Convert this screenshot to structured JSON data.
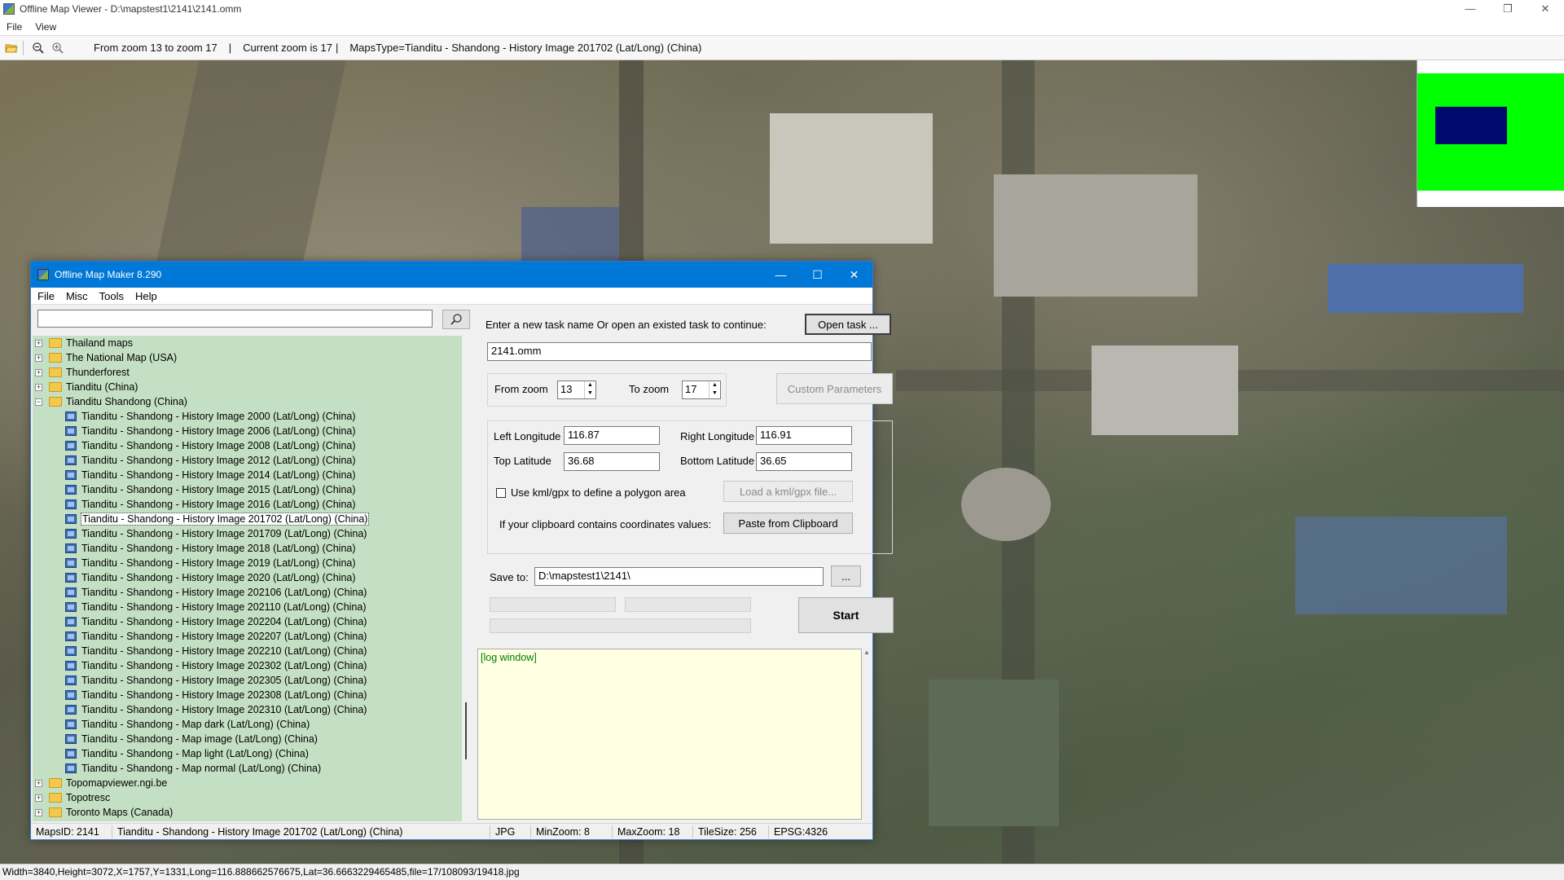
{
  "viewer": {
    "title": "Offline Map Viewer - D:\\mapstest1\\2141\\2141.omm",
    "controls": {
      "minimize": "—",
      "maximize": "❐",
      "close": "✕"
    },
    "menu": [
      "File",
      "View"
    ],
    "toolbar": {
      "zoom_range": "From zoom 13 to zoom 17",
      "current_zoom": "Current zoom is 17",
      "maps_type": "MapsType=Tianditu - Shandong - History Image 201702 (Lat/Long) (China)",
      "separator": "|"
    },
    "status": "Width=3840,Height=3072,X=1757,Y=1331,Long=116.888662576675,Lat=36.6663229465485,file=17/108093/19418.jpg"
  },
  "dialog": {
    "title": "Offline Map Maker 8.290",
    "controls": {
      "minimize": "—",
      "maximize": "☐",
      "close": "✕"
    },
    "menu": [
      "File",
      "Misc",
      "Tools",
      "Help"
    ],
    "search": {
      "value": ""
    },
    "tree": [
      {
        "level": 1,
        "expander": "+",
        "label": "Thailand maps"
      },
      {
        "level": 1,
        "expander": "+",
        "label": "The National Map (USA)"
      },
      {
        "level": 1,
        "expander": "+",
        "label": "Thunderforest"
      },
      {
        "level": 1,
        "expander": "+",
        "label": "Tianditu (China)"
      },
      {
        "level": 1,
        "expander": "−",
        "label": "Tianditu Shandong (China)"
      },
      {
        "level": 2,
        "label": "Tianditu - Shandong - History Image 2000 (Lat/Long) (China)"
      },
      {
        "level": 2,
        "label": "Tianditu - Shandong - History Image 2006 (Lat/Long) (China)"
      },
      {
        "level": 2,
        "label": "Tianditu - Shandong - History Image 2008 (Lat/Long) (China)"
      },
      {
        "level": 2,
        "label": "Tianditu - Shandong - History Image 2012 (Lat/Long) (China)"
      },
      {
        "level": 2,
        "label": "Tianditu - Shandong - History Image 2014 (Lat/Long) (China)"
      },
      {
        "level": 2,
        "label": "Tianditu - Shandong - History Image 2015 (Lat/Long) (China)"
      },
      {
        "level": 2,
        "label": "Tianditu - Shandong - History Image 2016 (Lat/Long) (China)"
      },
      {
        "level": 2,
        "label": "Tianditu - Shandong - History Image 201702 (Lat/Long) (China)",
        "selected": true
      },
      {
        "level": 2,
        "label": "Tianditu - Shandong - History Image 201709 (Lat/Long) (China)"
      },
      {
        "level": 2,
        "label": "Tianditu - Shandong - History Image 2018 (Lat/Long) (China)"
      },
      {
        "level": 2,
        "label": "Tianditu - Shandong - History Image 2019 (Lat/Long) (China)"
      },
      {
        "level": 2,
        "label": "Tianditu - Shandong - History Image 2020 (Lat/Long) (China)"
      },
      {
        "level": 2,
        "label": "Tianditu - Shandong - History Image 202106 (Lat/Long) (China)"
      },
      {
        "level": 2,
        "label": "Tianditu - Shandong - History Image 202110 (Lat/Long) (China)"
      },
      {
        "level": 2,
        "label": "Tianditu - Shandong - History Image 202204 (Lat/Long) (China)"
      },
      {
        "level": 2,
        "label": "Tianditu - Shandong - History Image 202207 (Lat/Long) (China)"
      },
      {
        "level": 2,
        "label": "Tianditu - Shandong - History Image 202210 (Lat/Long) (China)"
      },
      {
        "level": 2,
        "label": "Tianditu - Shandong - History Image 202302 (Lat/Long) (China)"
      },
      {
        "level": 2,
        "label": "Tianditu - Shandong - History Image 202305 (Lat/Long) (China)"
      },
      {
        "level": 2,
        "label": "Tianditu - Shandong - History Image 202308 (Lat/Long) (China)"
      },
      {
        "level": 2,
        "label": "Tianditu - Shandong - History Image 202310 (Lat/Long) (China)"
      },
      {
        "level": 2,
        "label": "Tianditu - Shandong - Map dark (Lat/Long) (China)"
      },
      {
        "level": 2,
        "label": "Tianditu - Shandong - Map image (Lat/Long) (China)"
      },
      {
        "level": 2,
        "label": "Tianditu - Shandong - Map light (Lat/Long) (China)"
      },
      {
        "level": 2,
        "label": "Tianditu - Shandong - Map normal (Lat/Long) (China)"
      },
      {
        "level": 1,
        "expander": "+",
        "label": "Topomapviewer.ngi.be"
      },
      {
        "level": 1,
        "expander": "+",
        "label": "Topotresc"
      },
      {
        "level": 1,
        "expander": "+",
        "label": "Toronto Maps (Canada)"
      }
    ],
    "task": {
      "prompt": "Enter a new task name Or open an existed task to continue:",
      "open_label": "Open task ...",
      "name_value": "2141.omm"
    },
    "zoom": {
      "from_label": "From zoom",
      "from_value": "13",
      "to_label": "To zoom",
      "to_value": "17",
      "custom_label": "Custom Parameters"
    },
    "coords": {
      "left_lon_label": "Left Longitude",
      "left_lon_value": "116.87",
      "right_lon_label": "Right Longitude",
      "right_lon_value": "116.91",
      "top_lat_label": "Top Latitude",
      "top_lat_value": "36.68",
      "bottom_lat_label": "Bottom Latitude",
      "bottom_lat_value": "36.65",
      "kml_check_label": "Use kml/gpx to define a polygon area",
      "kml_button_label": "Load a kml/gpx file...",
      "clipboard_prompt": "If your clipboard contains coordinates values:",
      "paste_label": "Paste from Clipboard"
    },
    "save": {
      "label": "Save to:",
      "value": "D:\\mapstest1\\2141\\",
      "browse_label": "..."
    },
    "start_label": "Start",
    "log_text": "[log window]",
    "status": {
      "maps_id": "MapsID: 2141",
      "map_name": "Tianditu - Shandong - History Image 201702 (Lat/Long) (China)",
      "format": "JPG",
      "min_zoom": "MinZoom: 8",
      "max_zoom": "MaxZoom: 18",
      "tile_size": "TileSize: 256",
      "epsg": "EPSG:4326"
    }
  }
}
